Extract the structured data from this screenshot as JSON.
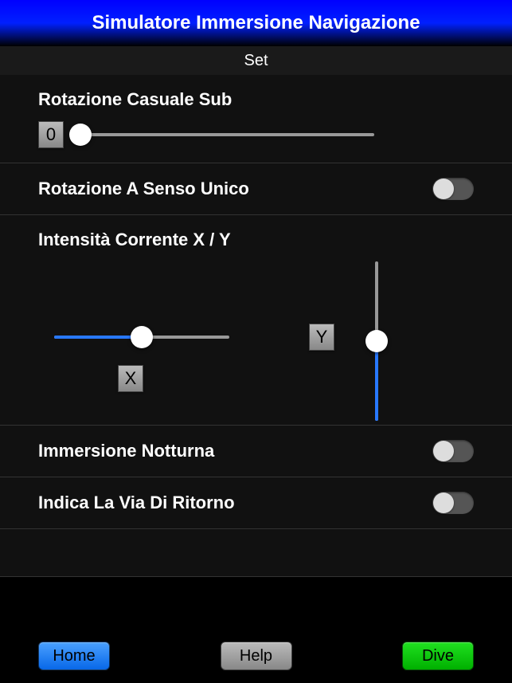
{
  "header": {
    "title": "Simulatore Immersione Navigazione",
    "subtitle": "Set"
  },
  "rotation": {
    "label": "Rotazione Casuale Sub",
    "value": "0",
    "slider_percent": 3
  },
  "one_way": {
    "label": "Rotazione A Senso Unico",
    "enabled": false
  },
  "intensity": {
    "label": "Intensità Corrente X / Y",
    "x_label": "X",
    "y_label": "Y",
    "x_percent": 50,
    "y_percent": 50
  },
  "night_dive": {
    "label": "Immersione Notturna",
    "enabled": false
  },
  "way_back": {
    "label": "Indica La Via Di Ritorno",
    "enabled": false
  },
  "buttons": {
    "home": "Home",
    "help": "Help",
    "dive": "Dive"
  }
}
